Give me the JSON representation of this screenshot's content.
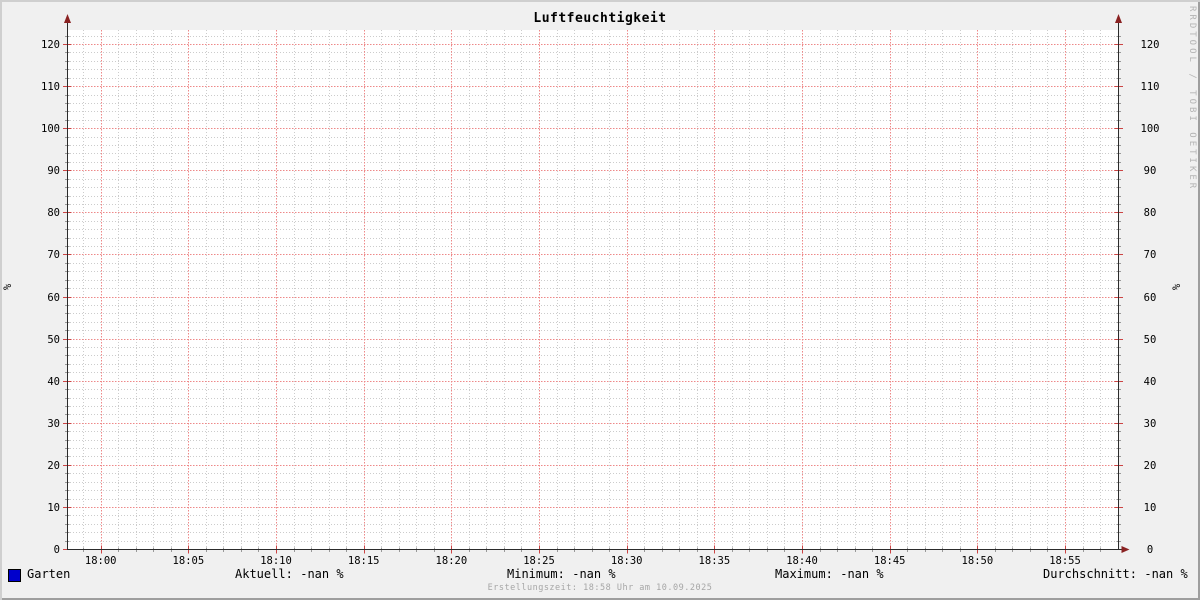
{
  "title": "Luftfeuchtigkeit",
  "watermark": "RRDTOOL / TOBI OETIKER",
  "footer": "Erstellungszeit: 18:58 Uhr am 10.09.2025",
  "y_axis_label": "%",
  "legend": {
    "series_label": "Garten",
    "swatch_color": "#0000cc"
  },
  "stats": {
    "aktuell": {
      "label": "Aktuell:",
      "value": "-nan %"
    },
    "minimum": {
      "label": "Minimum:",
      "value": "-nan %"
    },
    "maximum": {
      "label": "Maximum:",
      "value": "-nan %"
    },
    "durchschnitt": {
      "label": "Durchschnitt:",
      "value": "-nan %"
    }
  },
  "colors": {
    "background": "#f0f0f0",
    "canvas": "#ffffff",
    "bevel_light": "#cfcfcf",
    "bevel_dark": "#9e9e9e",
    "major_grid": "#ee8888",
    "minor_grid": "#cccccc",
    "axis": "#2b2b2b",
    "arrow": "#8a2222",
    "major_tick": "#cc4444",
    "minor_tick": "#999999",
    "series_garten": "#0000cc",
    "text": "#000000",
    "muted_text": "#a6a6a6"
  },
  "chart_data": {
    "type": "line",
    "title": "Luftfeuchtigkeit",
    "xlabel": "",
    "ylabel": "%",
    "ylim": [
      0,
      123
    ],
    "y_major_ticks": [
      0,
      10,
      20,
      30,
      40,
      50,
      60,
      70,
      80,
      90,
      100,
      110,
      120
    ],
    "y_minor_step": 2,
    "x_tick_labels": [
      "18:00",
      "18:05",
      "18:10",
      "18:15",
      "18:20",
      "18:25",
      "18:30",
      "18:35",
      "18:40",
      "18:45",
      "18:50",
      "18:55"
    ],
    "x_major_step_minutes": 5,
    "x_minor_step_minutes": 1,
    "grid": true,
    "legend_position": "bottom-left",
    "series": [
      {
        "name": "Garten",
        "color": "#0000cc",
        "values": [],
        "note_displayed_stats": "-nan"
      }
    ]
  }
}
